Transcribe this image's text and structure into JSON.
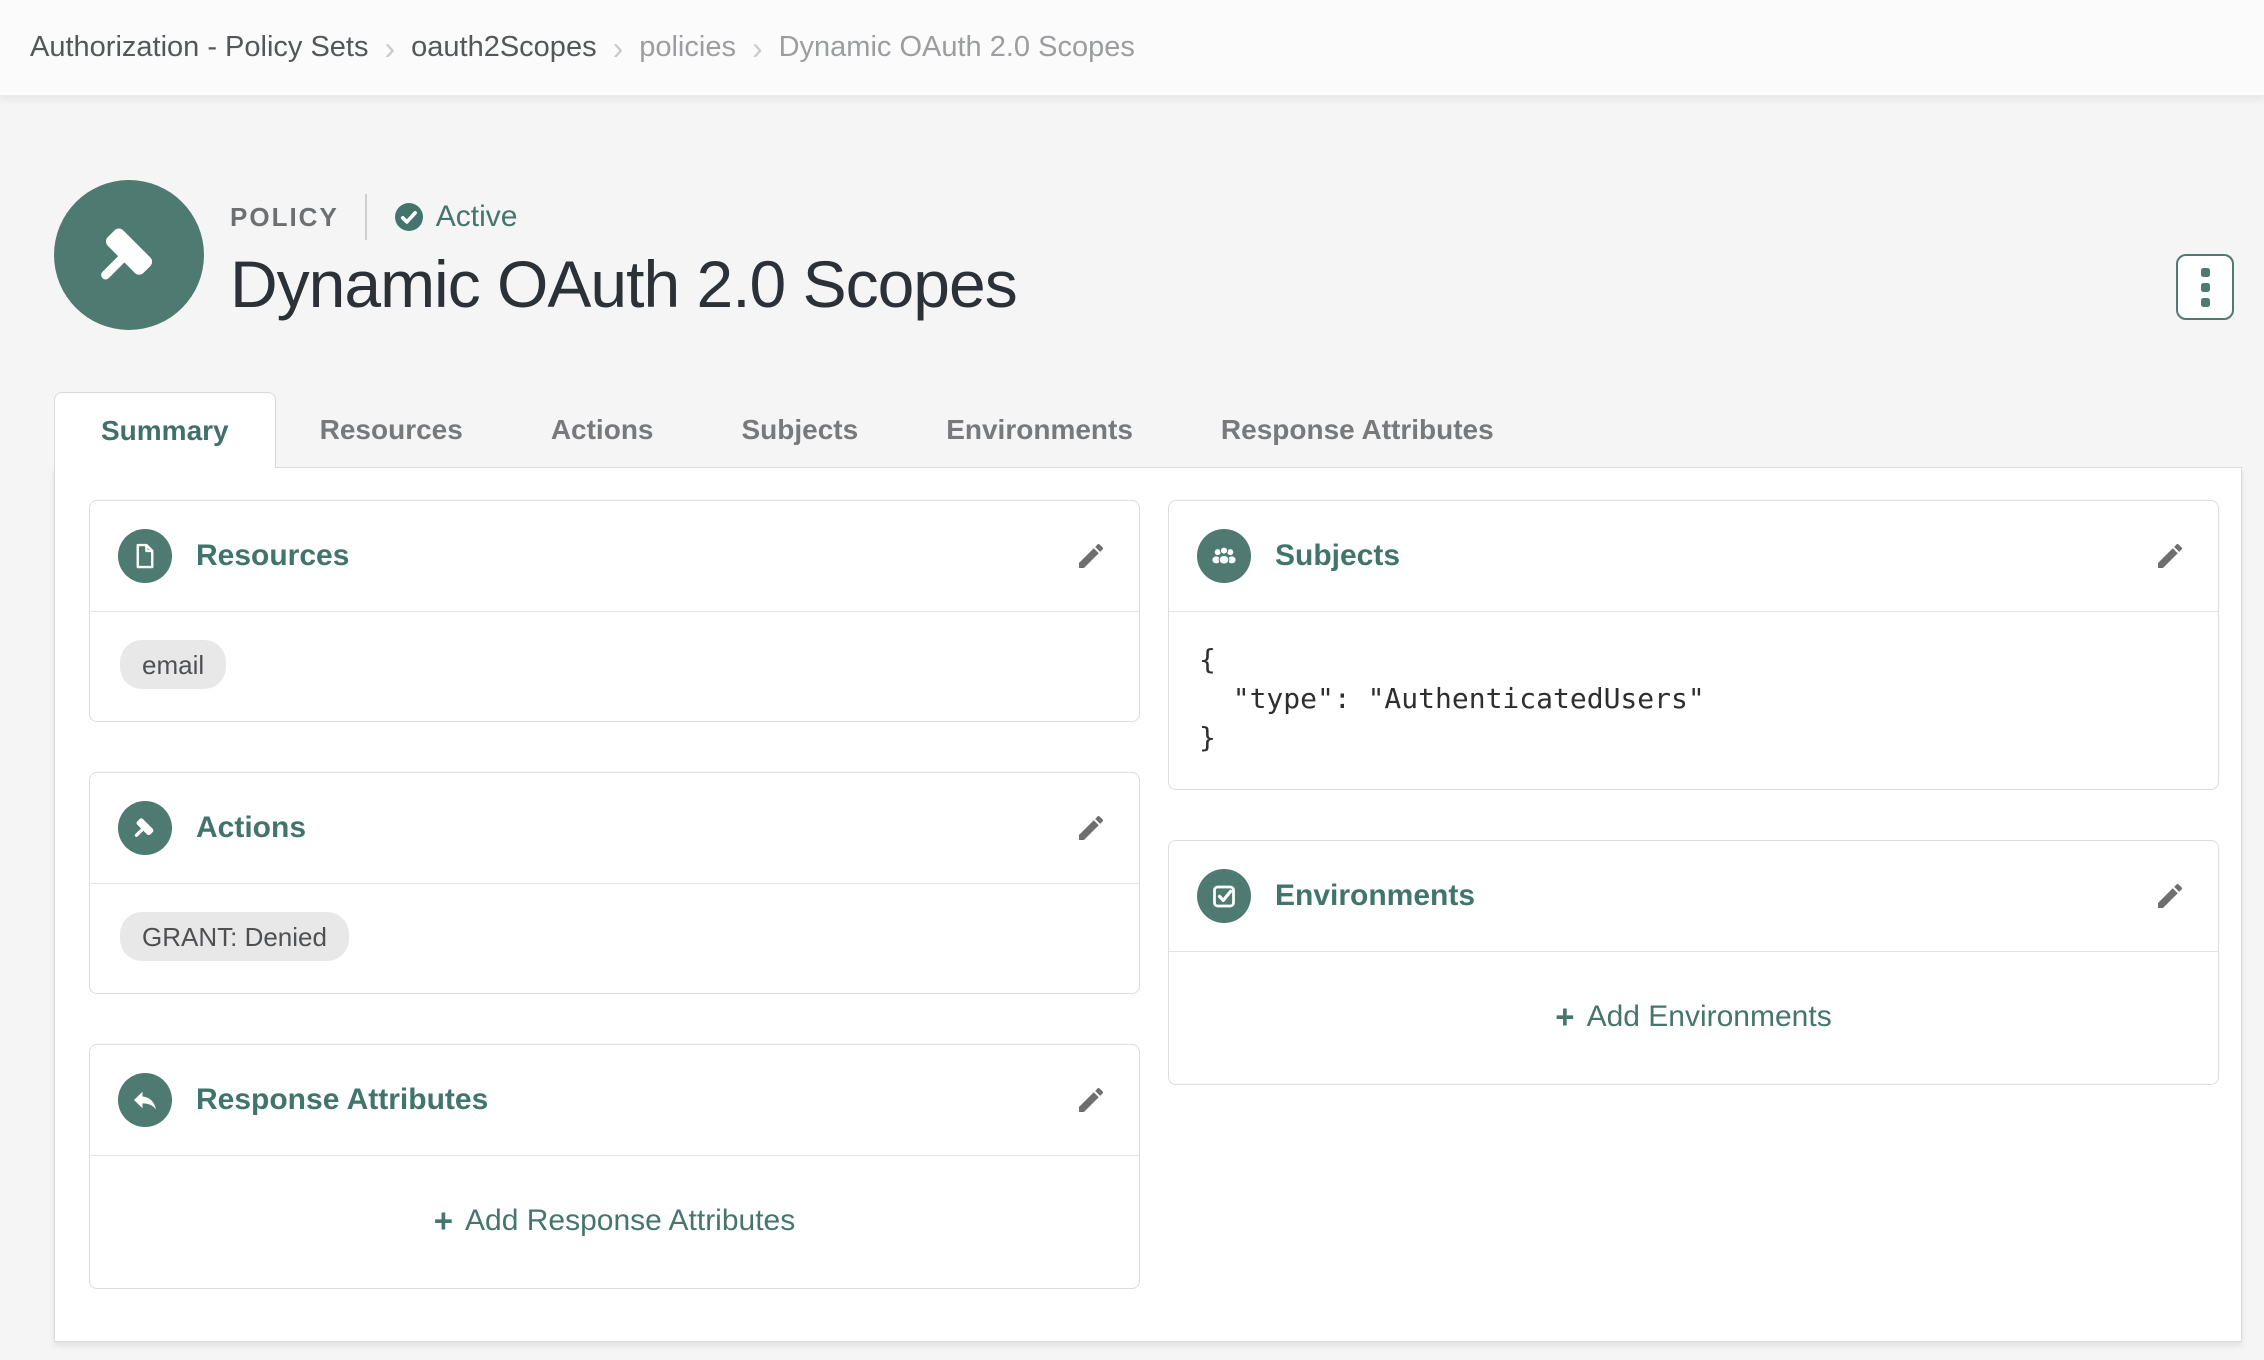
{
  "breadcrumb": {
    "separator": "›",
    "items": [
      "Authorization - Policy Sets",
      "oauth2Scopes",
      "policies",
      "Dynamic OAuth 2.0 Scopes"
    ]
  },
  "header": {
    "type_label": "POLICY",
    "status_label": "Active",
    "title": "Dynamic OAuth 2.0 Scopes"
  },
  "tabs": [
    {
      "label": "Summary",
      "active": true
    },
    {
      "label": "Resources",
      "active": false
    },
    {
      "label": "Actions",
      "active": false
    },
    {
      "label": "Subjects",
      "active": false
    },
    {
      "label": "Environments",
      "active": false
    },
    {
      "label": "Response Attributes",
      "active": false
    }
  ],
  "cards": {
    "resources": {
      "title": "Resources",
      "tags": [
        "email"
      ]
    },
    "actions": {
      "title": "Actions",
      "tags": [
        "GRANT: Denied"
      ]
    },
    "response_attributes": {
      "title": "Response Attributes",
      "plus": "+",
      "add_label": "Add Response Attributes"
    },
    "subjects": {
      "title": "Subjects",
      "code": "{\n  \"type\": \"AuthenticatedUsers\"\n}"
    },
    "environments": {
      "title": "Environments",
      "plus": "+",
      "add_label": "Add Environments"
    }
  },
  "icons": {
    "avatar": "gavel-icon",
    "status": "check-circle-icon",
    "more_options": "kebab-vertical-icon",
    "resources": "document-icon",
    "actions": "gavel-icon",
    "subjects": "users-icon",
    "environments": "check-square-icon",
    "response_attributes": "reply-arrow-icon",
    "edit": "pencil-icon",
    "breadcrumb_separator": "chevron-right-icon"
  },
  "colors": {
    "accent": "#4E7A72",
    "accent_text": "#45756C",
    "status_text": "#44746B",
    "title_text": "#2B3136",
    "page_background": "#F5F5F6",
    "pill_background": "#E8E8E9",
    "card_border": "#DCDCDD"
  }
}
